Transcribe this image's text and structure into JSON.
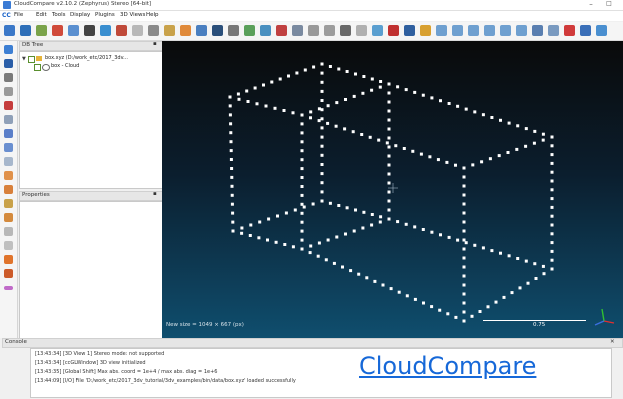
{
  "window": {
    "title": "CloudCompare v2.10.2 (Zephyrus) Stereo [64-bit]",
    "minimize_glyph": "–",
    "maximize_glyph": "□"
  },
  "menu": {
    "logo": "CC",
    "items": [
      "File",
      "Edit",
      "Tools",
      "Display",
      "Plugins",
      "3D Views",
      "Help"
    ]
  },
  "toolbar_icons": [
    "open-icon",
    "save-icon",
    "merge-icon",
    "clone-icon",
    "subsample-icon",
    "delete-icon",
    "translate-icon",
    "scalar-field-icon",
    "normals-icon",
    "mesh-icon",
    "octree-icon",
    "segment-icon",
    "pick-icon",
    "sor-icon",
    "noise-icon",
    "distance-icon",
    "align-icon",
    "plus-icon",
    "stats-icon",
    "compute-icon",
    "sf-icon",
    "cross-section-icon",
    "profile-icon",
    "point-list-icon",
    "label-icon",
    "camera-icon",
    "sp-icon",
    "view-front-icon",
    "view-top-icon",
    "view-left-icon",
    "view-back-icon",
    "view-right-icon",
    "view-iso-icon",
    "settings-icon",
    "rgb-icon",
    "bend-icon",
    "cloud-icon",
    "rgb-icon-2"
  ],
  "colors": {
    "accent": "#1a63c9",
    "view_top": "#0a0a0a",
    "view_bottom": "#0f4e6e",
    "points": "#ffffff",
    "link": "#1668d8"
  },
  "db_tree": {
    "title": "DB Tree",
    "items": [
      {
        "label": "box.xyz (D:/work_etc/2017_3dv...",
        "level": 0
      },
      {
        "label": "box - Cloud",
        "level": 1
      }
    ]
  },
  "properties": {
    "title": "Properties"
  },
  "view3d": {
    "new_size": "New size = 1049 × 667 (px)",
    "scale_label": "0.75"
  },
  "console": {
    "title": "Console",
    "lines": [
      "[13:43:34] [3D View 1] Stereo mode: not supported",
      "[13:43:34] [ccGLWindow] 3D view initialized",
      "[13:43:35] [Global Shift] Max abs. coord = 1e+4 / max abs. diag = 1e+6",
      "[13:44:09] [I/O] File 'D:/work_etc/2017_3dv_tutorial/3dv_examples/bin/data/box.xyz' loaded successfully"
    ],
    "overlay_link": "CloudCompare"
  }
}
